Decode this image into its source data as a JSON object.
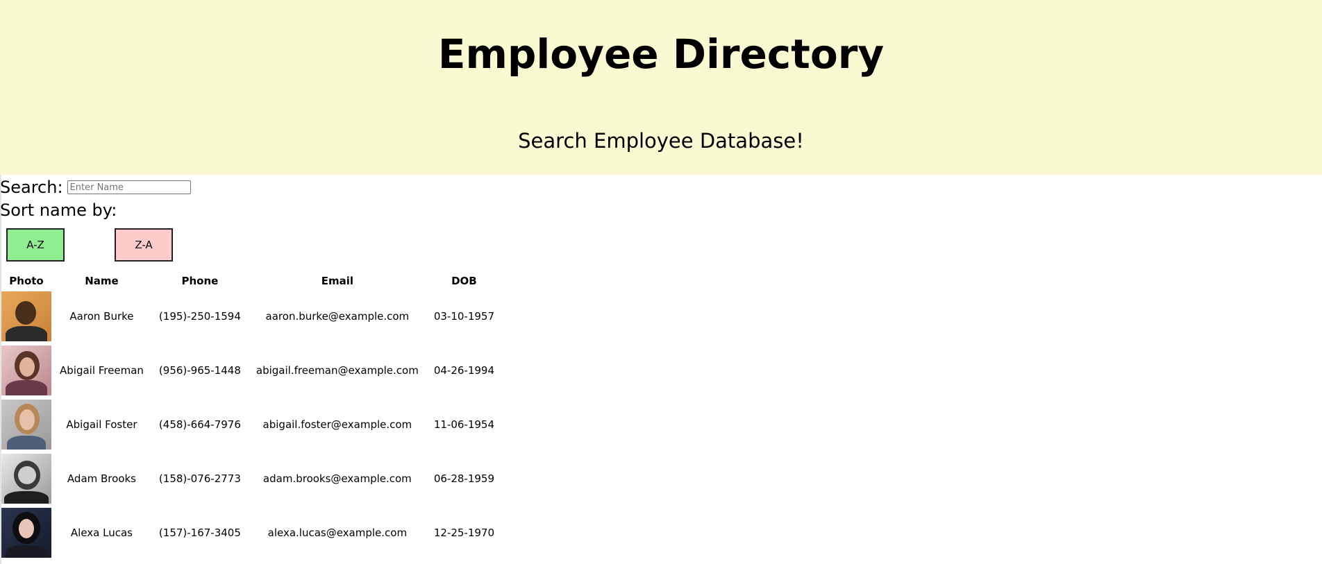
{
  "header": {
    "title": "Employee Directory",
    "subtitle": "Search Employee Database!",
    "background": "#fafad2"
  },
  "search": {
    "label": "Search:",
    "placeholder": "Enter Name",
    "value": ""
  },
  "sort": {
    "label": "Sort name by:",
    "az_label": "A-Z",
    "za_label": "Z-A",
    "az_color": "#90ee90",
    "za_color": "#ffcccb"
  },
  "table": {
    "columns": [
      "Photo",
      "Name",
      "Phone",
      "Email",
      "DOB"
    ],
    "rows": [
      {
        "photo": "avatar-photo",
        "name": "Aaron Burke",
        "phone": "(195)-250-1594",
        "email": "aaron.burke@example.com",
        "dob": "03-10-1957"
      },
      {
        "photo": "avatar-photo",
        "name": "Abigail Freeman",
        "phone": "(956)-965-1448",
        "email": "abigail.freeman@example.com",
        "dob": "04-26-1994"
      },
      {
        "photo": "avatar-photo",
        "name": "Abigail Foster",
        "phone": "(458)-664-7976",
        "email": "abigail.foster@example.com",
        "dob": "11-06-1954"
      },
      {
        "photo": "avatar-photo",
        "name": "Adam Brooks",
        "phone": "(158)-076-2773",
        "email": "adam.brooks@example.com",
        "dob": "06-28-1959"
      },
      {
        "photo": "avatar-photo",
        "name": "Alexa Lucas",
        "phone": "(157)-167-3405",
        "email": "alexa.lucas@example.com",
        "dob": "12-25-1970"
      }
    ]
  }
}
